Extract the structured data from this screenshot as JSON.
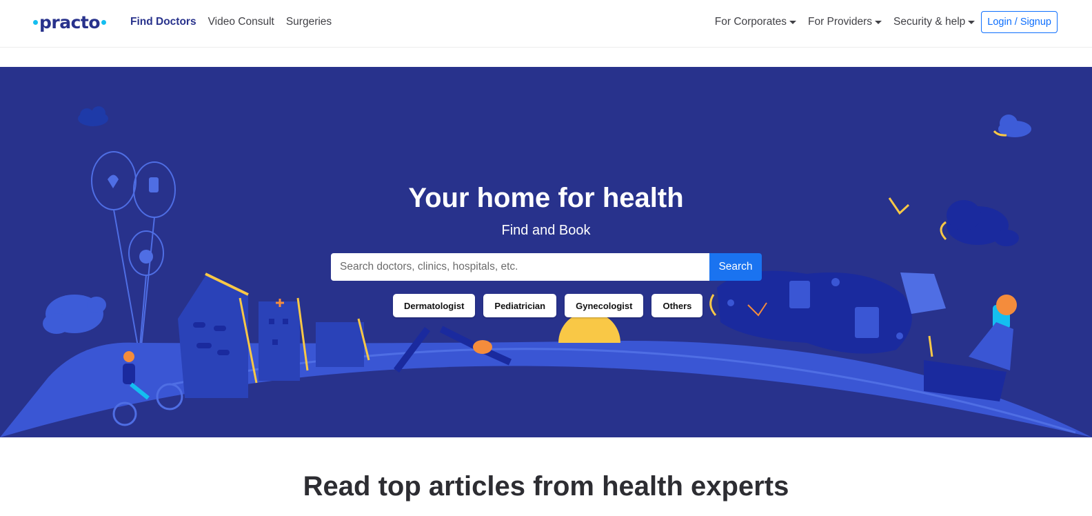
{
  "brand": {
    "name": "practo",
    "colors": {
      "navy": "#28328c",
      "accent": "#14bef0",
      "primary": "#0d6efd"
    }
  },
  "nav": {
    "left": [
      {
        "label": "Find Doctors",
        "active": true
      },
      {
        "label": "Video Consult",
        "active": false
      },
      {
        "label": "Surgeries",
        "active": false
      }
    ],
    "right": [
      {
        "label": "For Corporates",
        "icon": "caret-down-icon"
      },
      {
        "label": "For Providers",
        "icon": "caret-down-icon"
      },
      {
        "label": "Security & help",
        "icon": "caret-down-icon"
      }
    ],
    "login_label": "Login / Signup"
  },
  "hero": {
    "title": "Your home for health",
    "subtitle": "Find and Book",
    "search": {
      "placeholder": "Search doctors, clinics, hospitals, etc.",
      "value": "",
      "button_label": "Search"
    },
    "chips": [
      "Dermatologist",
      "Pediatrician",
      "Gynecologist",
      "Others"
    ]
  },
  "articles": {
    "title": "Read top articles from health experts"
  }
}
